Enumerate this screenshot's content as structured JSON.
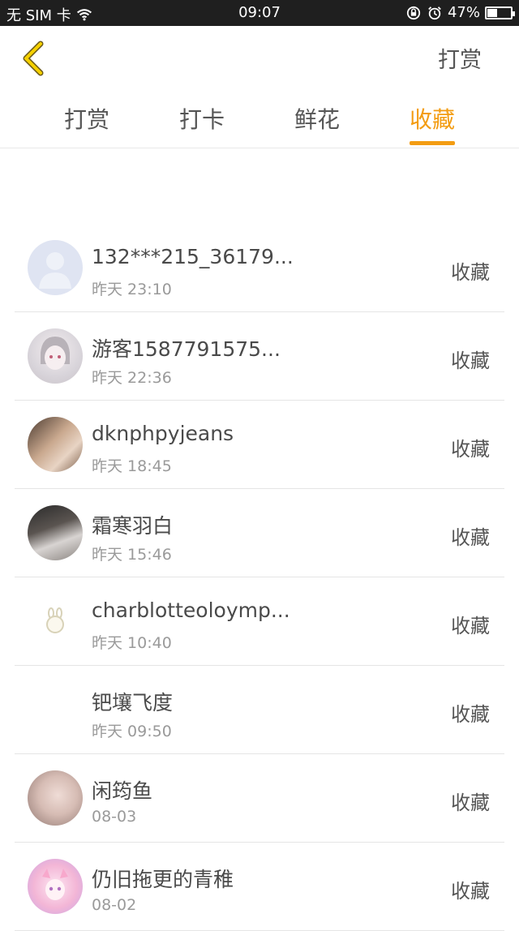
{
  "status_bar": {
    "carrier": "无 SIM 卡",
    "time": "09:07",
    "battery_percent": "47%",
    "battery_level": 0.47,
    "icons": [
      "wifi-icon",
      "lock-rotation-icon",
      "alarm-icon",
      "battery-icon"
    ]
  },
  "header": {
    "back_icon": "chevron-left-icon",
    "action_label": "打赏"
  },
  "tabs": [
    {
      "label": "打赏",
      "active": false
    },
    {
      "label": "打卡",
      "active": false
    },
    {
      "label": "鲜花",
      "active": false
    },
    {
      "label": "收藏",
      "active": true
    }
  ],
  "accent_color": "#f39c12",
  "list": [
    {
      "name": "132***215_36179...",
      "time": "昨天 23:10",
      "action": "收藏",
      "avatar": "default-user-avatar"
    },
    {
      "name": "游客1587791575...",
      "time": "昨天 22:36",
      "action": "收藏",
      "avatar": "anime-avatar"
    },
    {
      "name": "dknphpyjeans",
      "time": "昨天 18:45",
      "action": "收藏",
      "avatar": "photo-avatar"
    },
    {
      "name": "霜寒羽白",
      "time": "昨天 15:46",
      "action": "收藏",
      "avatar": "photo-avatar"
    },
    {
      "name": "charblotteoloymp...",
      "time": "昨天 10:40",
      "action": "收藏",
      "avatar": "small-icon-avatar"
    },
    {
      "name": "钯壤飞度",
      "time": "昨天 09:50",
      "action": "收藏",
      "avatar": "empty-avatar"
    },
    {
      "name": "闲筠鱼",
      "time": "08-03",
      "action": "收藏",
      "avatar": "photo-avatar"
    },
    {
      "name": "仍旧拖更的青稚",
      "time": "08-02",
      "action": "收藏",
      "avatar": "anime-pink-avatar"
    }
  ]
}
